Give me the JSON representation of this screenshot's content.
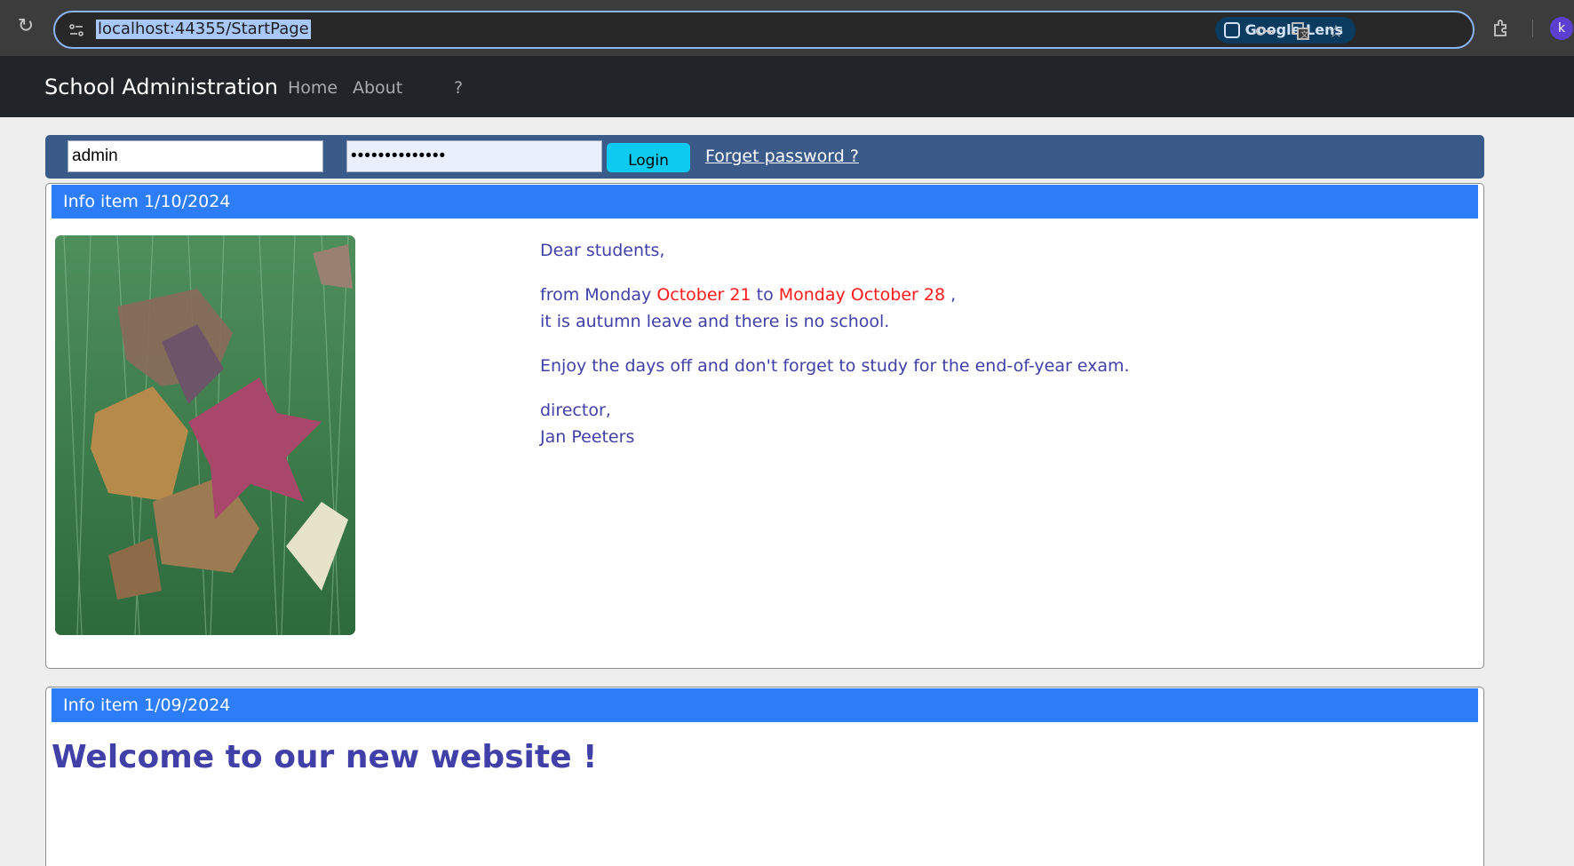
{
  "browser": {
    "url": "localhost:44355/StartPage",
    "lens_label": "Google Lens",
    "profile_initial": "k"
  },
  "navbar": {
    "brand": "School Administration",
    "links": [
      "Home",
      "About",
      "?"
    ]
  },
  "login": {
    "username_value": "admin",
    "password_value": "••••••••••••••",
    "login_label": "Login",
    "forgot_label": "Forget password ?"
  },
  "info_items": [
    {
      "header": "Info item 1/10/2024",
      "greeting": "Dear students,",
      "line1_pre": "from Monday ",
      "date_start": "October 21",
      "line1_mid": " to ",
      "date_end": "Monday October 28",
      "line1_post": " ,",
      "line2": "it is autumn leave and there is no school.",
      "line3": "Enjoy the days off and don't forget to study for the end-of-year exam.",
      "signoff": "director,",
      "signature": "Jan Peeters"
    },
    {
      "header": "Info item 1/09/2024",
      "heading": "Welcome to our new website !"
    }
  ],
  "colors": {
    "navbar_bg": "#212529",
    "login_bar_bg": "#3a5a89",
    "login_button": "#0dcaf0",
    "card_header": "#2e7df8",
    "text_accent": "#4040a8",
    "highlight": "#ff1a1a"
  }
}
